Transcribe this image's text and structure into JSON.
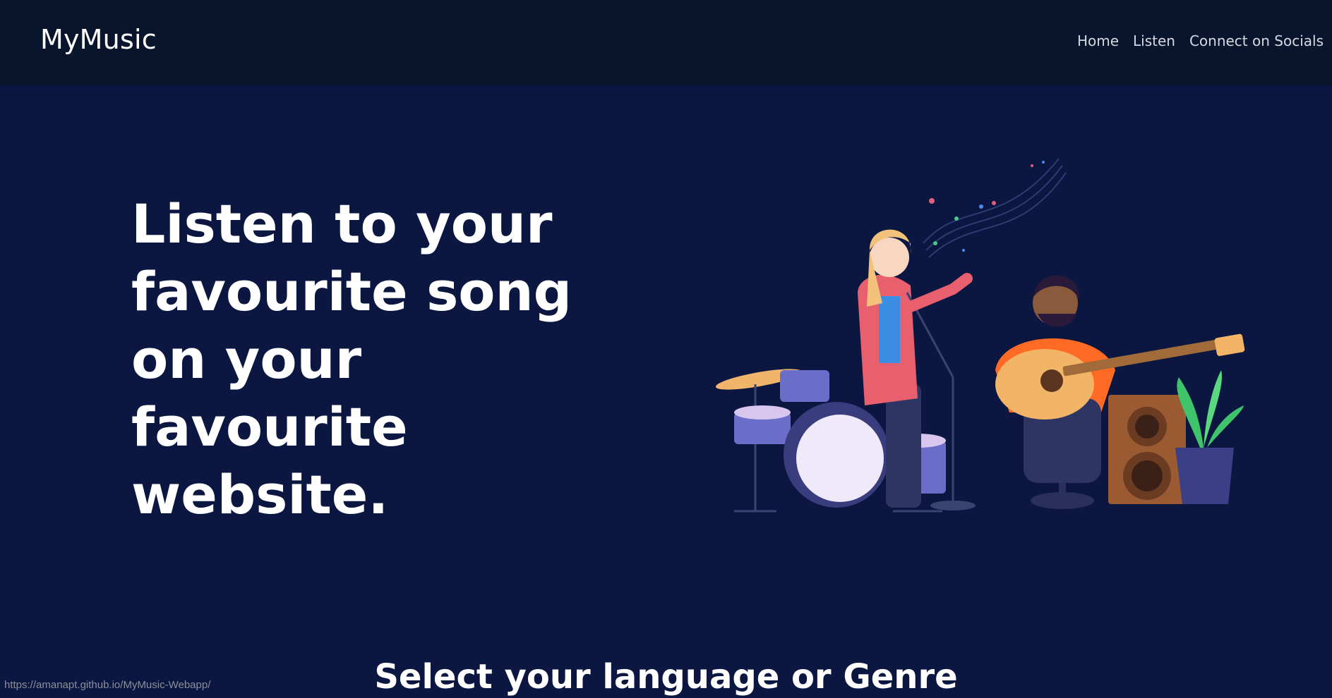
{
  "navbar": {
    "brand": "MyMusic",
    "links": [
      "Home",
      "Listen",
      "Connect on Socials"
    ]
  },
  "hero": {
    "heading": "Listen to your favourite song on your favourite website.",
    "illustration": "musicians-illustration"
  },
  "section": {
    "title": "Select your language or Genre"
  },
  "status_bar": {
    "url": "https://amanapt.github.io/MyMusic-Webapp/"
  },
  "colors": {
    "navbar_bg": "#09152d",
    "page_bg": "#0b1740",
    "text": "#ffffff",
    "nav_text": "#d6d9e1"
  }
}
